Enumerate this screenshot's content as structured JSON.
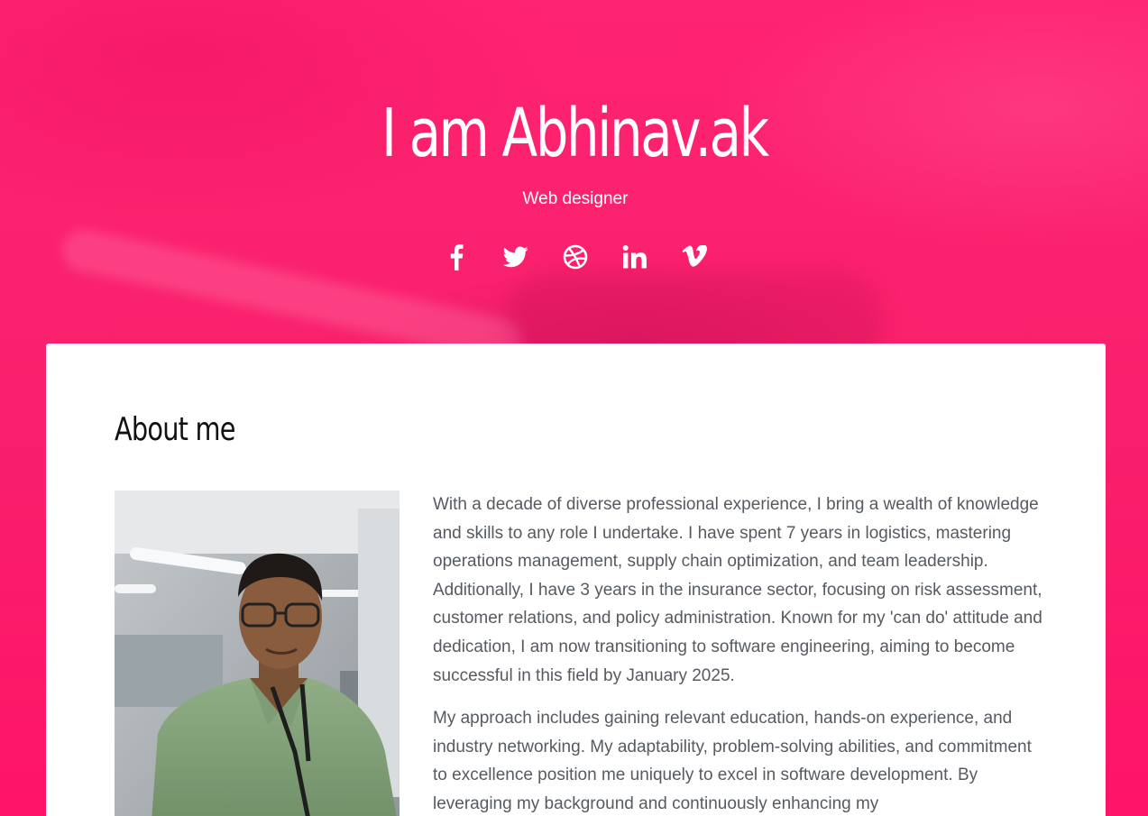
{
  "hero": {
    "title": "I am Abhinav.ak",
    "subtitle": "Web designer",
    "background_color": "#ff1a6b"
  },
  "socials": [
    {
      "icon": "facebook-icon"
    },
    {
      "icon": "twitter-icon"
    },
    {
      "icon": "dribbble-icon"
    },
    {
      "icon": "linkedin-icon"
    },
    {
      "icon": "vimeo-icon"
    }
  ],
  "about": {
    "heading": "About me",
    "paragraphs": [
      "With a decade of diverse professional experience, I bring a wealth of knowledge and skills to any role I undertake. I have spent 7 years in logistics, mastering operations management, supply chain optimization, and team leadership. Additionally, I have 3 years in the insurance sector, focusing on risk assessment, customer relations, and policy administration. Known for my 'can do' attitude and dedication, I am now transitioning to software engineering, aiming to become successful in this field by January 2025.",
      "My approach includes gaining relevant education, hands-on experience, and industry networking. My adaptability, problem-solving abilities, and commitment to excellence position me uniquely to excel in software development. By leveraging my background and continuously enhancing my"
    ]
  }
}
